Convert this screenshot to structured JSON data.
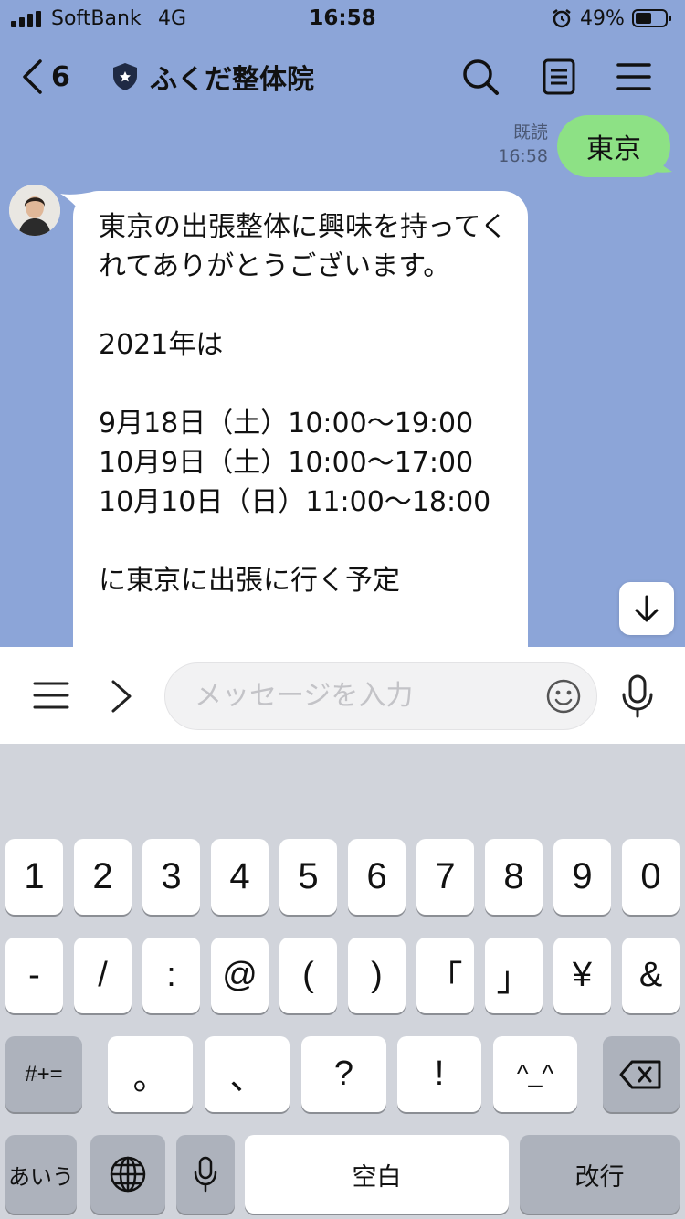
{
  "status_bar": {
    "carrier": "SoftBank",
    "network": "4G",
    "time": "16:58",
    "battery_percent": "49%"
  },
  "nav": {
    "back_count": "6",
    "title": "ふくだ整体院",
    "icons": [
      "back-chevron-icon",
      "shield-icon",
      "search-icon",
      "notes-icon",
      "menu-icon"
    ]
  },
  "messages": {
    "sent": {
      "read_label": "既読",
      "time": "16:58",
      "text": "東京"
    },
    "received": {
      "text": "東京の出張整体に興味を持ってくれてありがとうございます。\n\n2021年は\n\n9月18日（土）10:00〜19:00\n10月9日（土）10:00〜17:00\n10月10日（日）11:00〜18:00\n\nに東京に出張に行く予定"
    }
  },
  "input_bar": {
    "placeholder": "メッセージを入力"
  },
  "keyboard": {
    "row1": [
      "1",
      "2",
      "3",
      "4",
      "5",
      "6",
      "7",
      "8",
      "9",
      "0"
    ],
    "row2": [
      "-",
      "/",
      ":",
      "@",
      "(",
      ")",
      "「",
      "」",
      "¥",
      "&"
    ],
    "row3": [
      "#+=",
      "。",
      "、",
      "?",
      "!",
      "^_^"
    ],
    "row4": {
      "kana": "あいう",
      "space": "空白",
      "return": "改行"
    }
  },
  "colors": {
    "chat_background": "#8ca5d8",
    "sent_bubble": "#8de185",
    "received_bubble": "#ffffff",
    "keyboard_background": "#d1d4db"
  }
}
